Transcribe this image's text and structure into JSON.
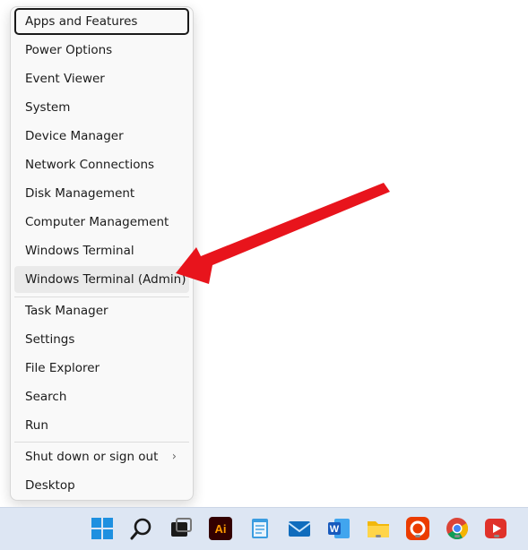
{
  "context_menu": {
    "items": [
      {
        "label": "Apps and Features"
      },
      {
        "label": "Power Options"
      },
      {
        "label": "Event Viewer"
      },
      {
        "label": "System"
      },
      {
        "label": "Device Manager"
      },
      {
        "label": "Network Connections"
      },
      {
        "label": "Disk Management"
      },
      {
        "label": "Computer Management"
      },
      {
        "label": "Windows Terminal"
      },
      {
        "label": "Windows Terminal (Admin)"
      },
      {
        "label": "Task Manager"
      },
      {
        "label": "Settings"
      },
      {
        "label": "File Explorer"
      },
      {
        "label": "Search"
      },
      {
        "label": "Run"
      },
      {
        "label": "Shut down or sign out"
      },
      {
        "label": "Desktop"
      }
    ],
    "focused_item": "Apps and Features",
    "highlighted_item": "Windows Terminal (Admin)",
    "submenu_indicator": "›"
  },
  "annotation": {
    "arrow_color": "#e8141c"
  },
  "taskbar": {
    "icons": [
      {
        "name": "start-icon"
      },
      {
        "name": "search-icon"
      },
      {
        "name": "task-view-icon"
      },
      {
        "name": "adobe-illustrator-icon",
        "text": "Ai"
      },
      {
        "name": "notepad-icon"
      },
      {
        "name": "mail-icon"
      },
      {
        "name": "word-icon",
        "text": "W"
      },
      {
        "name": "file-explorer-icon"
      },
      {
        "name": "office-icon"
      },
      {
        "name": "chrome-icon"
      },
      {
        "name": "media-player-icon"
      }
    ]
  }
}
